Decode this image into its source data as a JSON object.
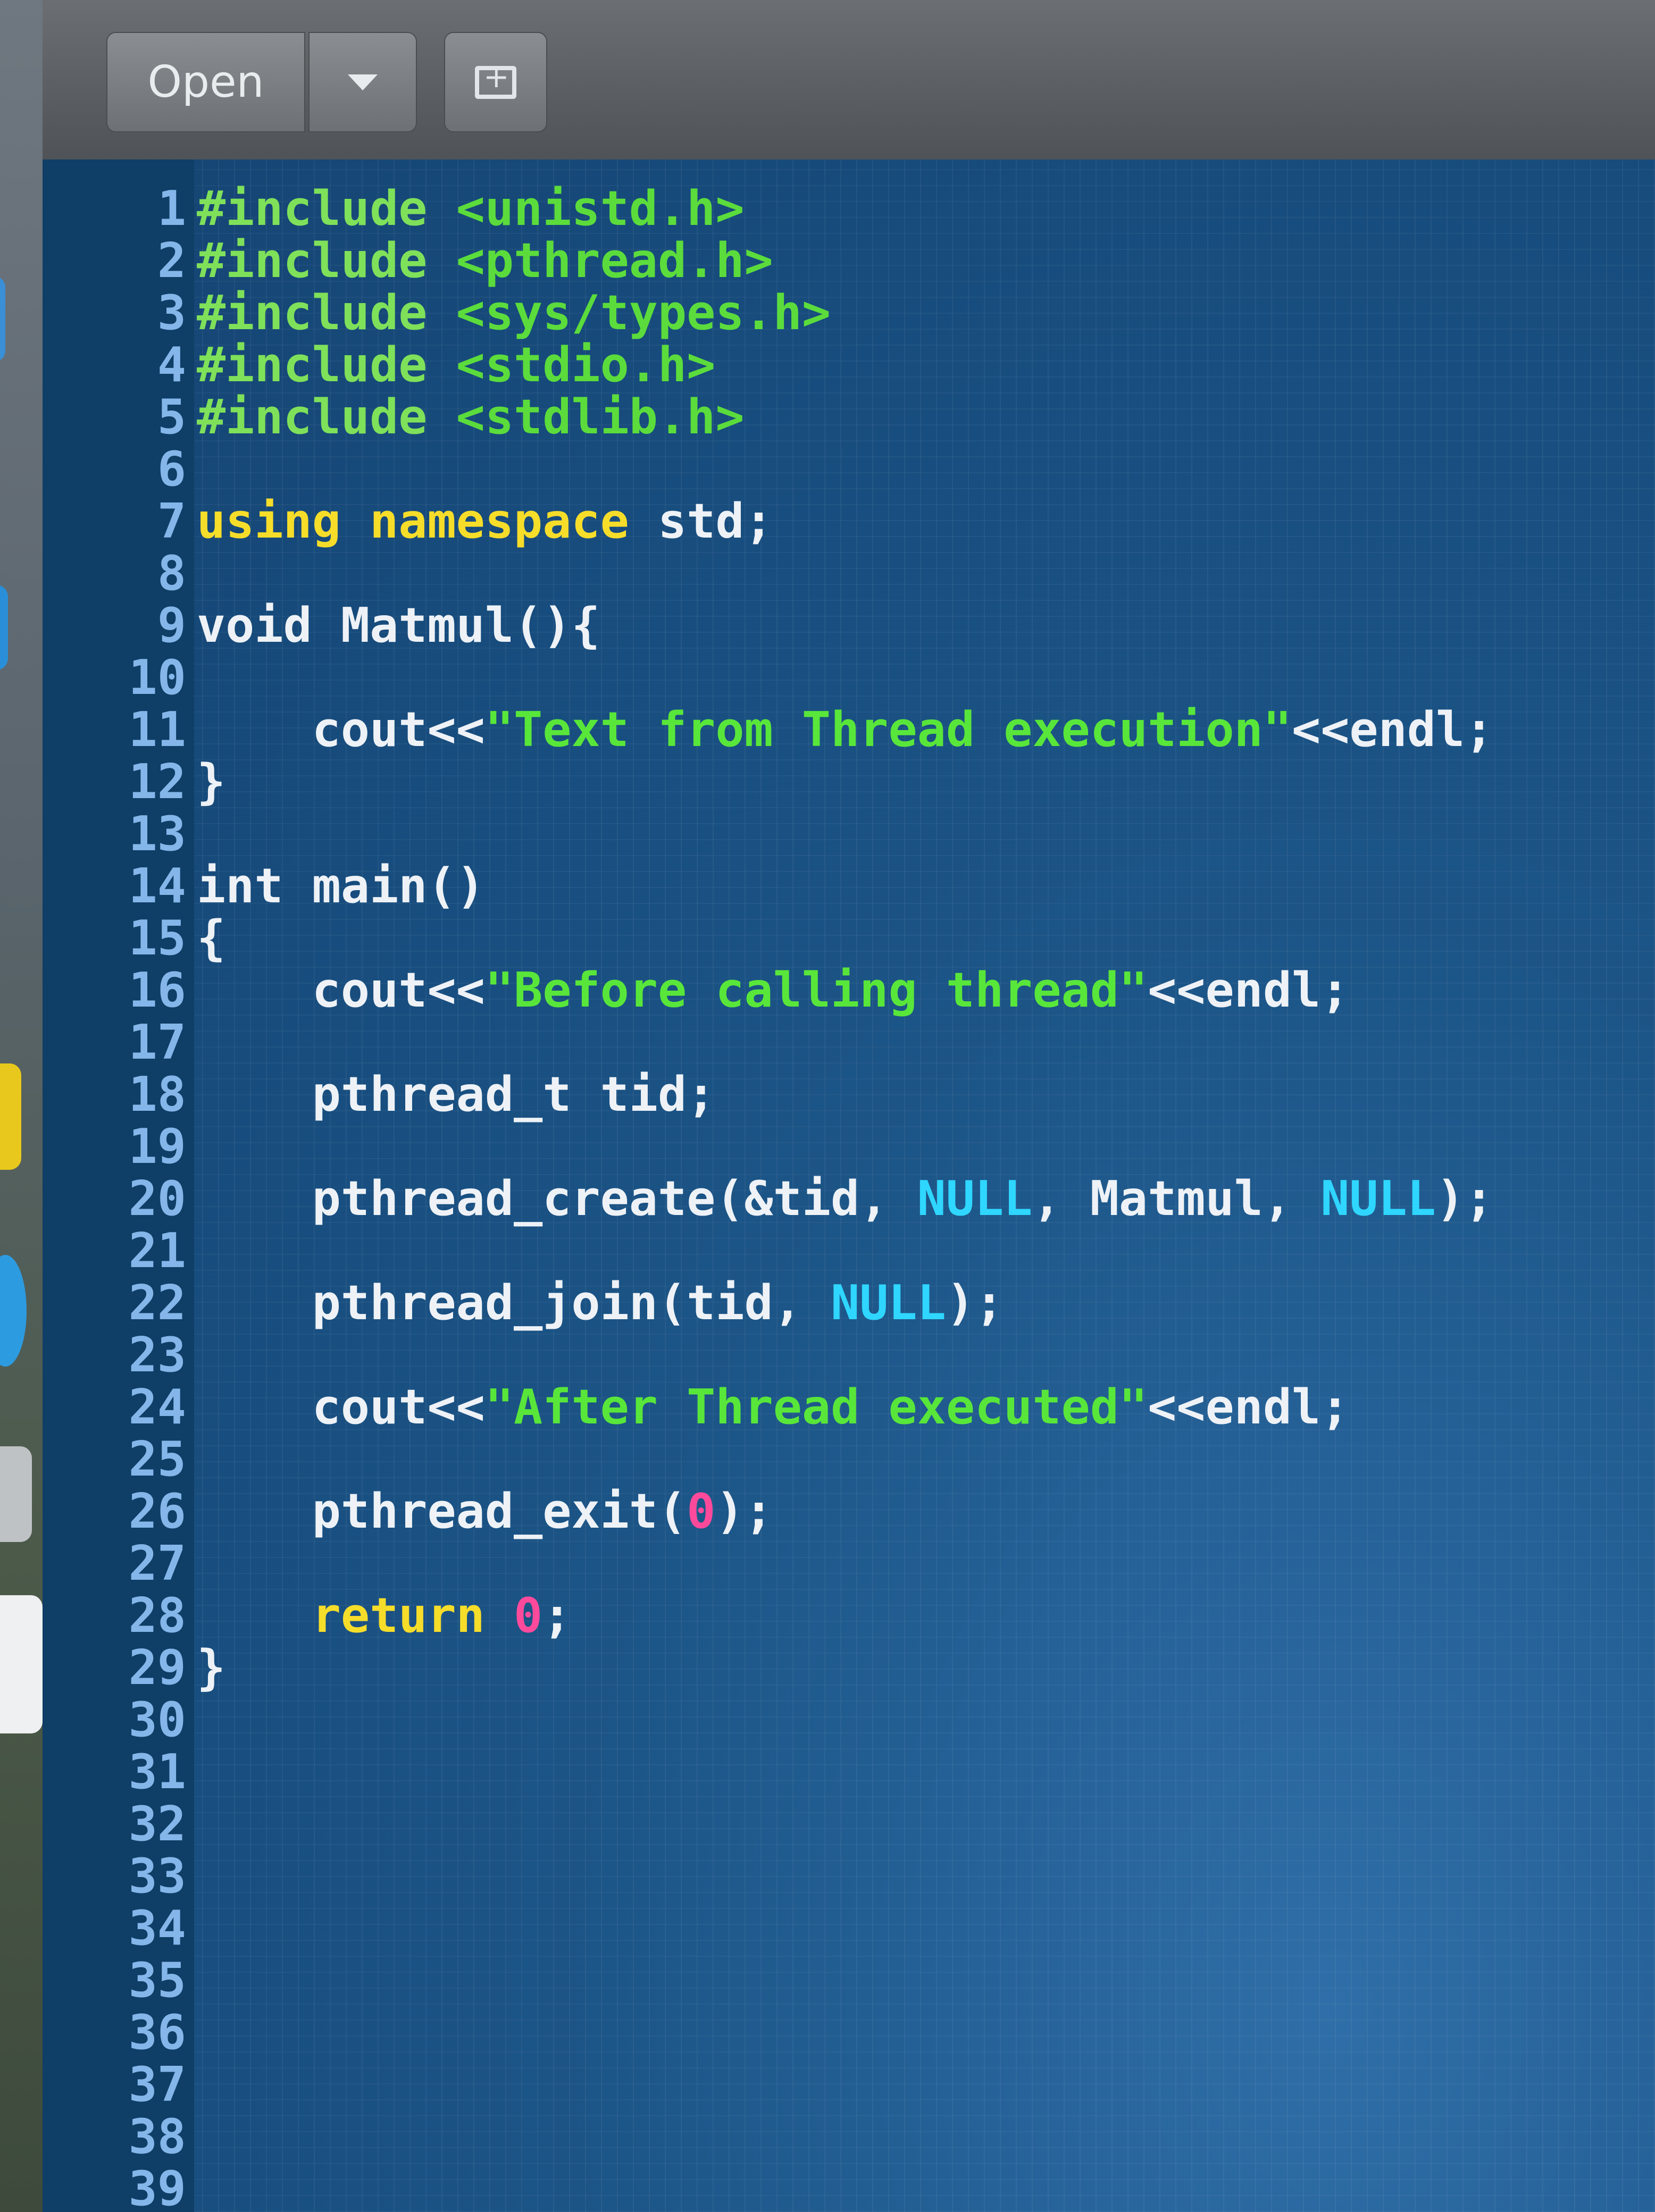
{
  "toolbar": {
    "open_label": "Open",
    "dropdown_icon": "chevron-down-icon",
    "new_document_icon": "new-document-icon"
  },
  "editor": {
    "line_numbers": [
      "1",
      "2",
      "3",
      "4",
      "5",
      "6",
      "7",
      "8",
      "9",
      "10",
      "11",
      "12",
      "13",
      "14",
      "15",
      "16",
      "17",
      "18",
      "19",
      "20",
      "21",
      "22",
      "23",
      "24",
      "25",
      "26",
      "27",
      "28",
      "29",
      "30",
      "31",
      "32",
      "33",
      "34",
      "35",
      "36",
      "37",
      "38",
      "39"
    ],
    "lines": [
      [
        [
          "pp",
          "#include "
        ],
        [
          "hdr",
          "<unistd.h>"
        ]
      ],
      [
        [
          "pp",
          "#include "
        ],
        [
          "hdr",
          "<pthread.h>"
        ]
      ],
      [
        [
          "pp",
          "#include "
        ],
        [
          "hdr",
          "<sys/types.h>"
        ]
      ],
      [
        [
          "pp",
          "#include "
        ],
        [
          "hdr",
          "<stdio.h>"
        ]
      ],
      [
        [
          "pp",
          "#include "
        ],
        [
          "hdr",
          "<stdlib.h>"
        ]
      ],
      [],
      [
        [
          "kw",
          "using namespace"
        ],
        [
          "ty",
          " std;"
        ]
      ],
      [],
      [
        [
          "ty",
          "void Matmul(){"
        ]
      ],
      [],
      [
        [
          "ty",
          "    cout<<"
        ],
        [
          "str",
          "\"Text from Thread execution\""
        ],
        [
          "ty",
          "<<endl;"
        ]
      ],
      [
        [
          "ty",
          "}"
        ]
      ],
      [],
      [
        [
          "ty",
          "int main()"
        ]
      ],
      [
        [
          "ty",
          "{"
        ]
      ],
      [
        [
          "ty",
          "    cout<<"
        ],
        [
          "str",
          "\"Before calling thread\""
        ],
        [
          "ty",
          "<<endl;"
        ]
      ],
      [],
      [
        [
          "ty",
          "    pthread_t tid;"
        ]
      ],
      [],
      [
        [
          "ty",
          "    pthread_create(&tid, "
        ],
        [
          "cst",
          "NULL"
        ],
        [
          "ty",
          ", Matmul, "
        ],
        [
          "cst",
          "NULL"
        ],
        [
          "ty",
          ");"
        ]
      ],
      [],
      [
        [
          "ty",
          "    pthread_join(tid, "
        ],
        [
          "cst",
          "NULL"
        ],
        [
          "ty",
          ");"
        ]
      ],
      [],
      [
        [
          "ty",
          "    cout<<"
        ],
        [
          "str",
          "\"After Thread executed\""
        ],
        [
          "ty",
          "<<endl;"
        ]
      ],
      [],
      [
        [
          "ty",
          "    pthread_exit("
        ],
        [
          "num",
          "0"
        ],
        [
          "ty",
          ");"
        ]
      ],
      [],
      [
        [
          "ty",
          "    "
        ],
        [
          "kw",
          "return"
        ],
        [
          "ty",
          " "
        ],
        [
          "num",
          "0"
        ],
        [
          "ty",
          ";"
        ]
      ],
      [
        [
          "ty",
          "}"
        ]
      ],
      [],
      [],
      [],
      [],
      [],
      [],
      [],
      [],
      [],
      []
    ]
  },
  "colors": {
    "editor_bg": "#1c5587",
    "line_number": "#84b6ea",
    "keyword": "#f6dd2a",
    "string": "#59e63a",
    "constant": "#2fd6ff",
    "number": "#ff4a9c"
  }
}
